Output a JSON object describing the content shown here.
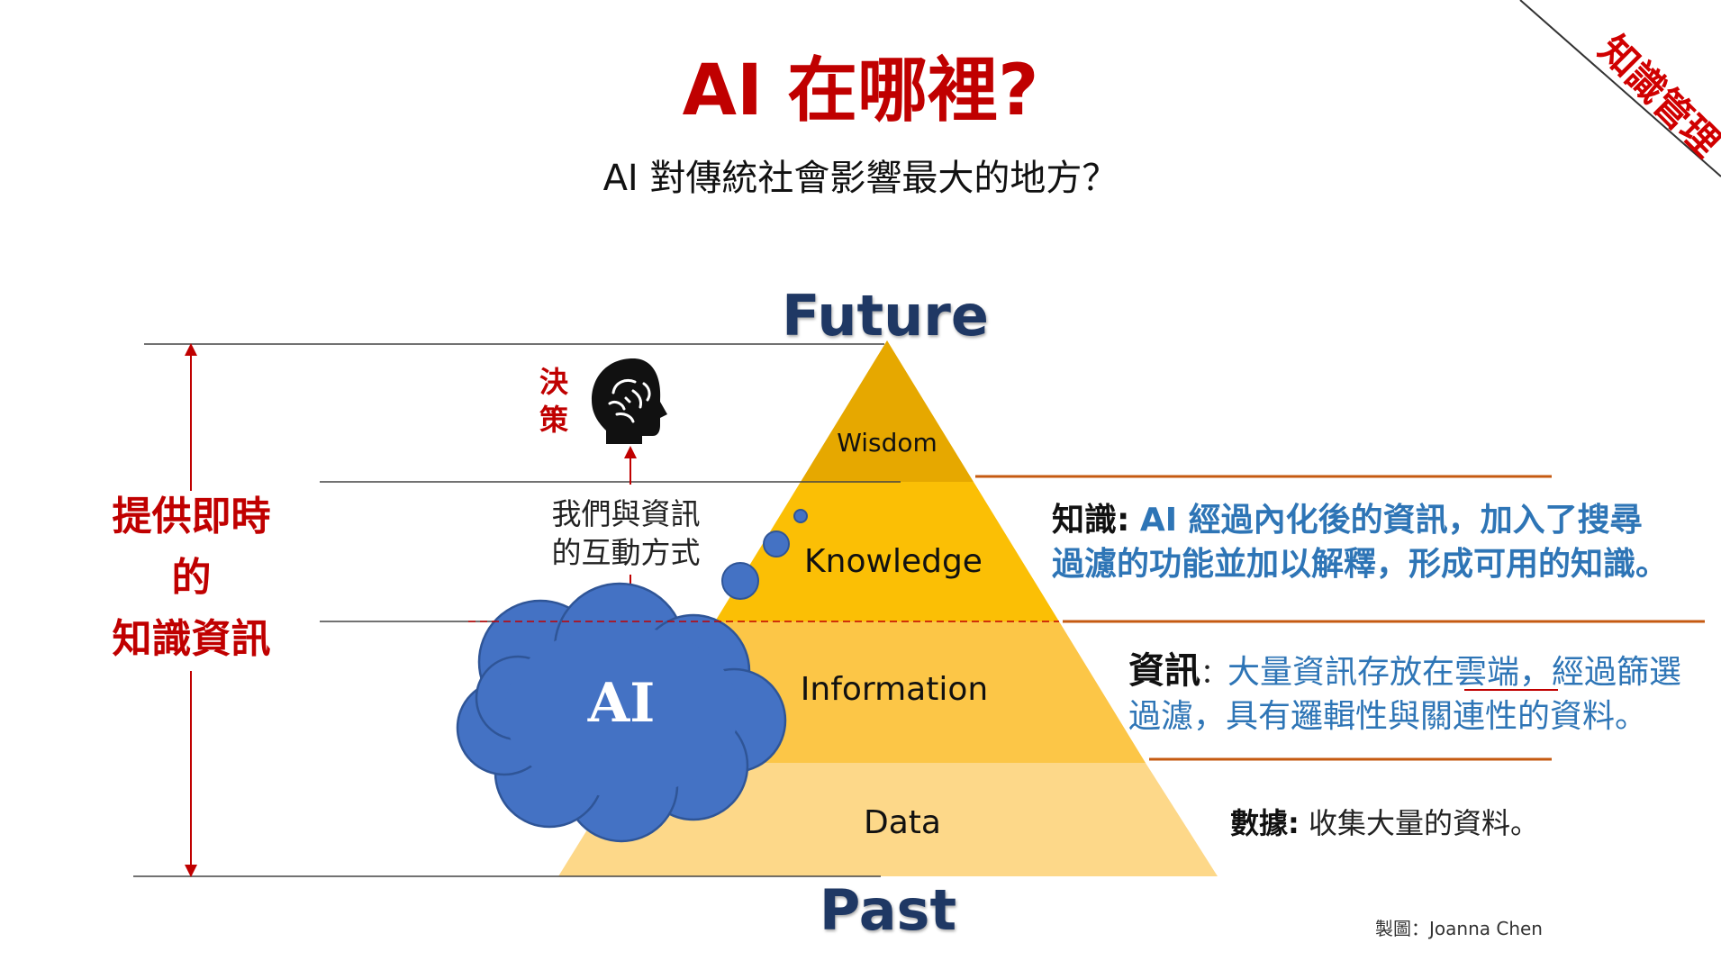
{
  "header": {
    "title": "AI 在哪裡?",
    "subtitle": "AI 對傳統社會影響最大的地方？",
    "corner_label": "知識管理"
  },
  "pyramid": {
    "top_label": "Future",
    "bottom_label": "Past",
    "colors": {
      "wisdom": "#e6a800",
      "knowledge": "#fbbf05",
      "information": "#fcc647",
      "data": "#fdd889"
    },
    "layers": [
      {
        "label": "Wisdom"
      },
      {
        "label": "Knowledge"
      },
      {
        "label": "Information"
      },
      {
        "label": "Data"
      }
    ]
  },
  "left_note": {
    "lines": [
      "提供即時",
      "的",
      "知識資訊"
    ],
    "color": "#c00000"
  },
  "decision": {
    "lines": [
      "決",
      "策"
    ],
    "icon": "brain-head-icon"
  },
  "interaction": {
    "lines": [
      "我們與資訊",
      "的互動方式"
    ]
  },
  "ai_cloud": {
    "label": "AI",
    "color": "#4472c4"
  },
  "descriptions": {
    "knowledge": {
      "key": "知識:",
      "line1": "AI 經過內化後的資訊，加入了搜尋",
      "line2": "過濾的功能並加以解釋，形成可用的知識。"
    },
    "information": {
      "key": "資訊",
      "sep": "：",
      "line1": "大量資訊存放在雲端，經過篩選",
      "line2": "過濾，具有邏輯性與關連性的資料。"
    },
    "data": {
      "key": "數據:",
      "value": "收集大量的資料。"
    }
  },
  "credit": "製圖：Joanna Chen"
}
